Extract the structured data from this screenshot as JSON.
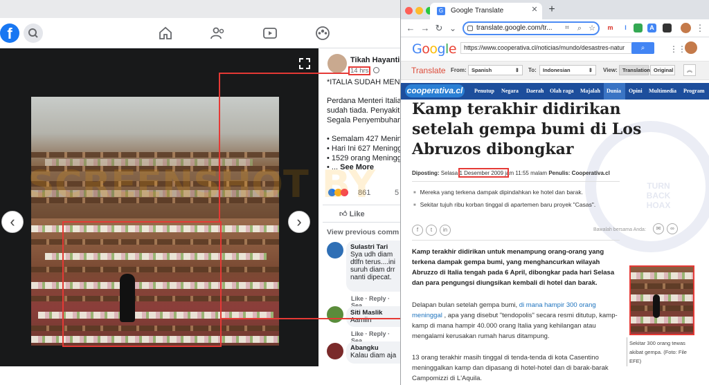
{
  "facebook": {
    "logo": "f",
    "post": {
      "author": "Tikah Hayanti",
      "time": "14 hrs",
      "headline": "*ITALIA SUDAH MEN",
      "lines": [
        "Perdana Menteri Italia",
        "sudah tiada. Penyakit",
        "Segala Penyembuhan"
      ],
      "bullets": [
        "• Semalam 427 Menin",
        "• Hari Ini 627 Meningg",
        "• 1529 orang Meningg"
      ],
      "see_more_prefix": "• ...",
      "see_more": "See More",
      "reaction_count": "861",
      "share_count": "5",
      "like_label": "Like",
      "view_previous": "View previous comm"
    },
    "comments": [
      {
        "name": "Sulastri Tari",
        "lines": [
          "Sya udh diam",
          "dtlfn terus....ini",
          "suruh diam drr",
          "nanti dipecat."
        ],
        "avatar_color": "#2f6fb5"
      },
      {
        "name": "Siti Maslik",
        "lines": [
          "Aamiin"
        ],
        "avatar_color": "#5b8c3b"
      },
      {
        "name": "Abangku",
        "lines": [
          "Kalau diam aja"
        ],
        "avatar_color": "#7a2a2a"
      }
    ],
    "comment_actions": "Like · Reply · Sea",
    "watermark": "SCREENSHOT BY"
  },
  "chrome": {
    "tab_title": "Google Translate",
    "address": "translate.google.com/tr...",
    "new_tab": "+",
    "ext_icons": [
      "m",
      "I",
      "",
      ""
    ]
  },
  "google": {
    "logo_letters": [
      {
        "ch": "G",
        "color": "#4285f4"
      },
      {
        "ch": "o",
        "color": "#ea4335"
      },
      {
        "ch": "o",
        "color": "#fbbc05"
      },
      {
        "ch": "g",
        "color": "#4285f4"
      },
      {
        "ch": "l",
        "color": "#34a853"
      },
      {
        "ch": "e",
        "color": "#ea4335"
      }
    ],
    "url_input": "https://www.cooperativa.cl/noticias/mundo/desastres-natur",
    "translate_title": "Translate",
    "from_label": "From:",
    "from_value": "Spanish",
    "to_label": "To:",
    "to_value": "Indonesian",
    "view_label": "View:",
    "view_translation": "Translation",
    "view_original": "Original"
  },
  "article": {
    "site_logo": "cooperativa.cl",
    "nav": [
      "Penutup",
      "Negara",
      "Daerah",
      "Olah raga",
      "Majalah",
      "Dunia",
      "Opini",
      "Multimedia",
      "Program"
    ],
    "title": "Kamp terakhir didirikan setelah gempa bumi di Los Abruzos dibongkar",
    "meta_label": "Diposting:",
    "meta_day": "Selasa",
    "meta_date": "1 Desember 2009",
    "meta_time": "jam 11:55 malam",
    "author_label": "Penulis:",
    "author": "Cooperativa.cl",
    "bullets": [
      "Mereka yang terkena dampak dipindahkan ke hotel dan barak.",
      "Sekitar tujuh ribu korban tinggal di apartemen baru proyek \"Casas\"."
    ],
    "share_label": "Bawalah bersama Anda:",
    "lead": "Kamp terakhir didirikan untuk menampung orang-orang yang terkena dampak gempa bumi, yang menghancurkan wilayah Abruzzo di Italia tengah pada 6 April, dibongkar pada hari Selasa dan para pengungsi diungsikan kembali di hotel dan barak.",
    "p1_a": "Delapan bulan setelah gempa bumi,",
    "p1_link": "di mana hampir 300 orang meninggal",
    "p1_b": ", apa yang disebut \"tendopolis\" secara resmi ditutup, kamp-kamp di mana hampir 40.000 orang Italia yang kehilangan atau mengalami kerusakan rumah harus ditampung.",
    "p2": "13 orang terakhir masih tinggal di tenda-tenda di kota Casentino meninggalkan kamp dan dipasang di hotel-hotel dan di barak-barak Campomizzi di L'Aquila.",
    "caption": "Sekitar 300 orang tewas akibat gempa. (Foto: File EFE)",
    "stamp_text": "TURN BACK HOAX"
  }
}
